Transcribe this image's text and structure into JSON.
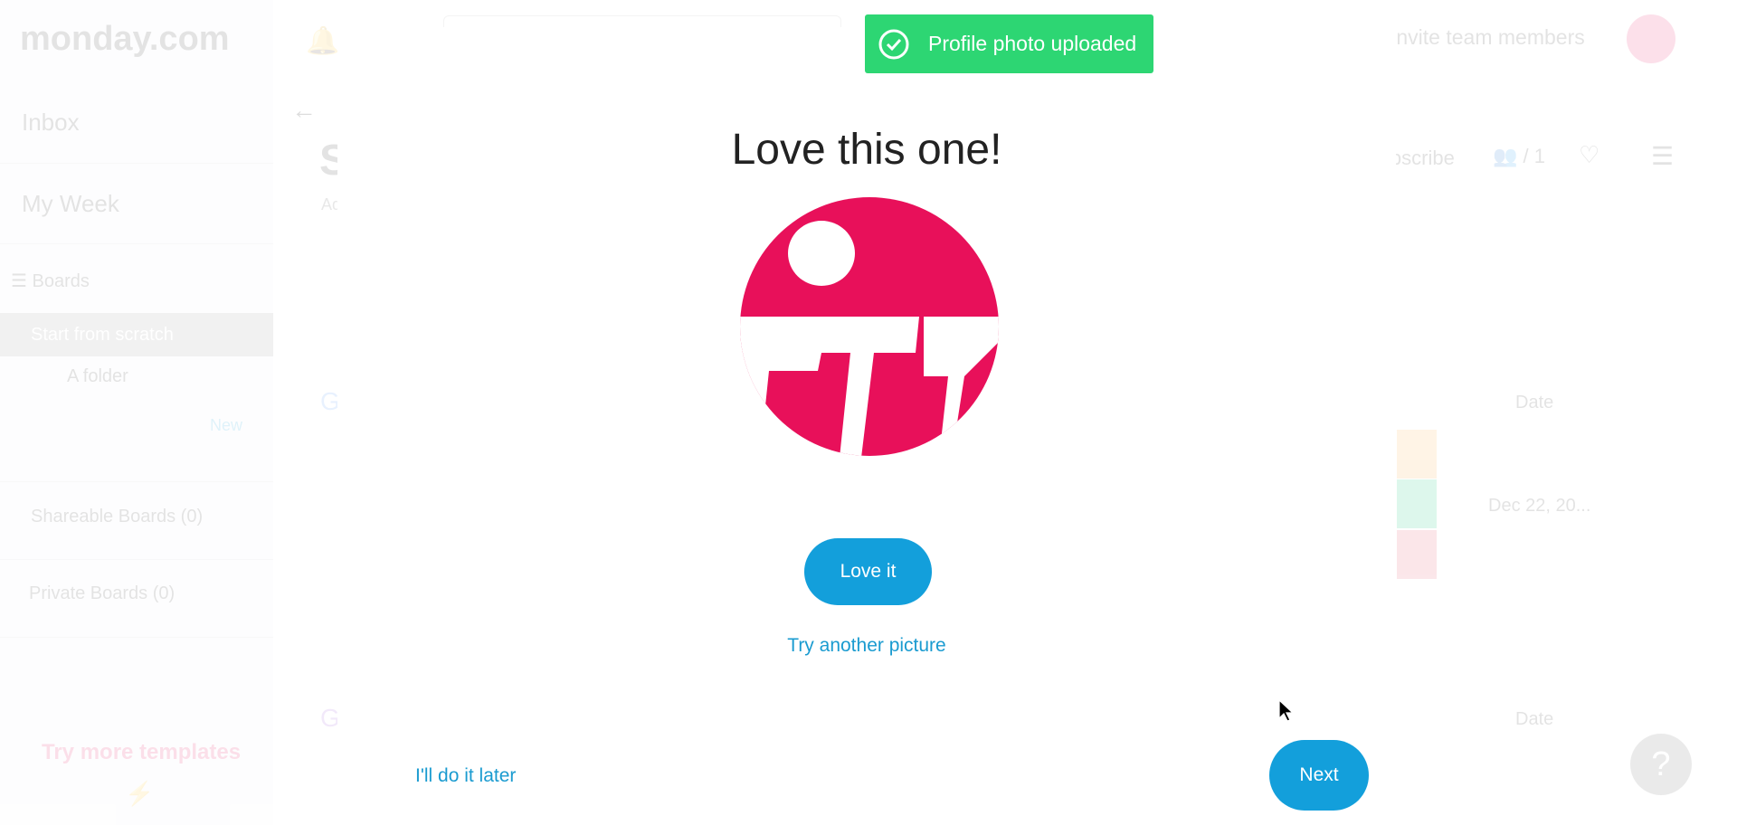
{
  "background": {
    "logo": "monday.com",
    "invite_label": "Invite team members",
    "sidebar": {
      "inbox": "Inbox",
      "my_week": "My Week",
      "boards": "Boards",
      "start_from_scratch": "Start from scratch",
      "folder": "A folder",
      "new": "New",
      "shareable_boards": "Shareable Boards",
      "shareable_count": "(0)",
      "private_boards": "Private Boards",
      "private_count": "(0)",
      "try_templates": "Try more templates"
    },
    "board": {
      "title_initial": "S",
      "subtitle_initial": "Ad",
      "subscribe": "Subscribe",
      "members": "/ 1",
      "group_initial": "G",
      "date_header": "Date",
      "date_value": "Dec 22, 20...",
      "status_colors": [
        "#fdab3d",
        "#00c875",
        "#e2445c"
      ]
    },
    "help": "?"
  },
  "toast": {
    "text": "Profile photo uploaded",
    "color": "#2dd673"
  },
  "modal": {
    "title": "Love this one!",
    "love_it": "Love it",
    "try_another": "Try another picture",
    "later": "I'll do it later",
    "next": "Next",
    "accent": "#139fdb",
    "avatar_color": "#e8105a"
  }
}
